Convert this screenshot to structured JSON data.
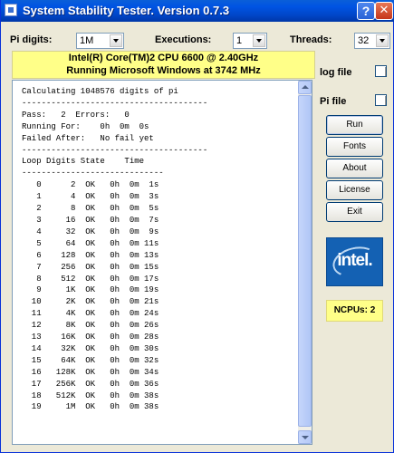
{
  "window": {
    "title": "System Stability Tester. Version 0.7.3",
    "help_label": "?",
    "close_label": "✕"
  },
  "settings": {
    "pi_digits_label": "Pi digits:",
    "pi_digits_value": "1M",
    "executions_label": "Executions:",
    "executions_value": "1",
    "threads_label": "Threads:",
    "threads_value": "32"
  },
  "cpu_info": {
    "line1": "Intel(R) Core(TM)2 CPU 6600 @ 2.40GHz",
    "line2": "Running Microsoft Windows at 3742 MHz"
  },
  "options": {
    "log_file_label": "log file",
    "log_file_checked": false,
    "pi_file_label": "Pi file",
    "pi_file_checked": false
  },
  "buttons": {
    "run": "Run",
    "fonts": "Fonts",
    "about": "About",
    "license": "License",
    "exit": "Exit"
  },
  "logo": {
    "text": "intel."
  },
  "ncpus": "NCPUs: 2",
  "output": {
    "header": [
      "Calculating 1048576 digits of pi",
      "--------------------------------------",
      "Pass:   2  Errors:   0",
      "Running For:    0h  0m  0s",
      "Failed After:   No fail yet",
      "--------------------------------------",
      "Loop Digits State    Time",
      "-----------------------------"
    ],
    "rows": [
      [
        "0",
        "2",
        "OK",
        "0h 0m 1s"
      ],
      [
        "1",
        "4",
        "OK",
        "0h 0m 3s"
      ],
      [
        "2",
        "8",
        "OK",
        "0h 0m 5s"
      ],
      [
        "3",
        "16",
        "OK",
        "0h 0m 7s"
      ],
      [
        "4",
        "32",
        "OK",
        "0h 0m 9s"
      ],
      [
        "5",
        "64",
        "OK",
        "0h 0m 11s"
      ],
      [
        "6",
        "128",
        "OK",
        "0h 0m 13s"
      ],
      [
        "7",
        "256",
        "OK",
        "0h 0m 15s"
      ],
      [
        "8",
        "512",
        "OK",
        "0h 0m 17s"
      ],
      [
        "9",
        "1K",
        "OK",
        "0h 0m 19s"
      ],
      [
        "10",
        "2K",
        "OK",
        "0h 0m 21s"
      ],
      [
        "11",
        "4K",
        "OK",
        "0h 0m 24s"
      ],
      [
        "12",
        "8K",
        "OK",
        "0h 0m 26s"
      ],
      [
        "13",
        "16K",
        "OK",
        "0h 0m 28s"
      ],
      [
        "14",
        "32K",
        "OK",
        "0h 0m 30s"
      ],
      [
        "15",
        "64K",
        "OK",
        "0h 0m 32s"
      ],
      [
        "16",
        "128K",
        "OK",
        "0h 0m 34s"
      ],
      [
        "17",
        "256K",
        "OK",
        "0h 0m 36s"
      ],
      [
        "18",
        "512K",
        "OK",
        "0h 0m 38s"
      ],
      [
        "19",
        "1M",
        "OK",
        "0h 0m 38s"
      ]
    ]
  }
}
